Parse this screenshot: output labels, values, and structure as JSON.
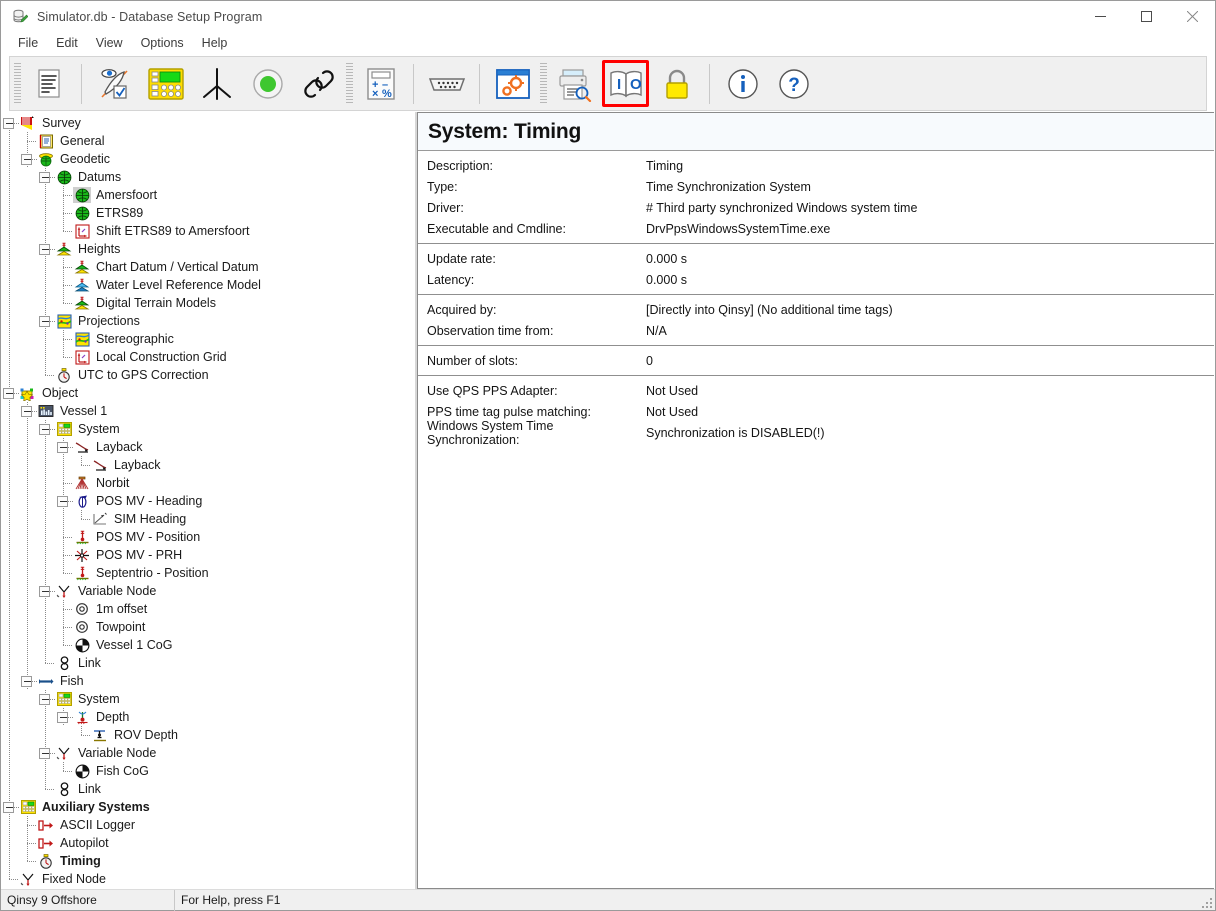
{
  "window": {
    "title": "Simulator.db - Database Setup Program",
    "icon": "database-program-icon",
    "controls": [
      {
        "name": "minimize-button",
        "glyph": "—"
      },
      {
        "name": "maximize-button",
        "glyph": "□"
      },
      {
        "name": "close-button",
        "glyph": "✕"
      }
    ]
  },
  "menu": {
    "items": [
      "File",
      "Edit",
      "View",
      "Options",
      "Help"
    ]
  },
  "toolbar": {
    "highlight_color": "#ff0000",
    "buttons": [
      {
        "name": "report-icon",
        "tip": "Report"
      },
      {
        "name": "survey-setup-icon",
        "tip": "Survey"
      },
      {
        "name": "computation-setup-icon",
        "tip": "Computation Setup"
      },
      {
        "name": "node-icon",
        "tip": "Node"
      },
      {
        "name": "object-icon",
        "tip": "Object"
      },
      {
        "name": "link-icon",
        "tip": "Link"
      },
      {
        "name": "calculator-icon",
        "tip": "Calculator"
      },
      {
        "name": "serial-port-icon",
        "tip": "I/O Ports"
      },
      {
        "name": "driver-settings-icon",
        "tip": "Driver Settings"
      },
      {
        "name": "print-preview-icon",
        "tip": "Print Preview"
      },
      {
        "name": "io-book-icon",
        "tip": "I/O Tester",
        "highlighted": true
      },
      {
        "name": "lock-icon",
        "tip": "Lock"
      },
      {
        "name": "info-icon",
        "tip": "About"
      },
      {
        "name": "help-icon",
        "tip": "Help"
      }
    ]
  },
  "tree": {
    "nodes": [
      {
        "label": "Survey",
        "depth": 0,
        "expander": "minus",
        "icon": "survey-icon",
        "last": false
      },
      {
        "label": "General",
        "depth": 1,
        "expander": "none",
        "icon": "general-icon",
        "last": false
      },
      {
        "label": "Geodetic",
        "depth": 1,
        "expander": "minus",
        "icon": "geodetic-icon",
        "last": true
      },
      {
        "label": "Datums",
        "depth": 2,
        "expander": "minus",
        "icon": "datum-globe-icon",
        "last": false
      },
      {
        "label": "Amersfoort",
        "depth": 3,
        "expander": "none",
        "icon": "datum-globe-icon",
        "last": false,
        "selected": true
      },
      {
        "label": "ETRS89",
        "depth": 3,
        "expander": "none",
        "icon": "datum-globe-icon",
        "last": false
      },
      {
        "label": "Shift ETRS89 to Amersfoort",
        "depth": 3,
        "expander": "none",
        "icon": "shift-axes-icon",
        "last": true
      },
      {
        "label": "Heights",
        "depth": 2,
        "expander": "minus",
        "icon": "heights-icon",
        "last": false
      },
      {
        "label": "Chart Datum / Vertical Datum",
        "depth": 3,
        "expander": "none",
        "icon": "heights-icon",
        "last": false
      },
      {
        "label": "Water Level Reference Model",
        "depth": 3,
        "expander": "none",
        "icon": "waterlevel-icon",
        "last": false
      },
      {
        "label": "Digital Terrain Models",
        "depth": 3,
        "expander": "none",
        "icon": "heights-icon",
        "last": true
      },
      {
        "label": "Projections",
        "depth": 2,
        "expander": "minus",
        "icon": "projection-icon",
        "last": false
      },
      {
        "label": "Stereographic",
        "depth": 3,
        "expander": "none",
        "icon": "projection-icon",
        "last": false
      },
      {
        "label": "Local Construction Grid",
        "depth": 3,
        "expander": "none",
        "icon": "shift-axes-icon",
        "last": true
      },
      {
        "label": "UTC to GPS Correction",
        "depth": 2,
        "expander": "none",
        "icon": "stopwatch-icon",
        "last": true
      },
      {
        "label": "Object",
        "depth": 0,
        "expander": "minus",
        "icon": "object-icon",
        "last": false
      },
      {
        "label": "Vessel 1",
        "depth": 1,
        "expander": "minus",
        "icon": "vessel-icon",
        "last": false
      },
      {
        "label": "System",
        "depth": 2,
        "expander": "minus",
        "icon": "system-icon",
        "last": false
      },
      {
        "label": "Layback",
        "depth": 3,
        "expander": "minus",
        "icon": "layback-icon",
        "last": false
      },
      {
        "label": "Layback",
        "depth": 4,
        "expander": "none",
        "icon": "layback-icon",
        "last": true
      },
      {
        "label": "Norbit",
        "depth": 3,
        "expander": "none",
        "icon": "multibeam-icon",
        "last": false
      },
      {
        "label": "POS MV - Heading",
        "depth": 3,
        "expander": "minus",
        "icon": "gyro-icon",
        "last": false
      },
      {
        "label": "SIM Heading",
        "depth": 4,
        "expander": "none",
        "icon": "sim-heading-icon",
        "last": true
      },
      {
        "label": "POS MV - Position",
        "depth": 3,
        "expander": "none",
        "icon": "position-icon",
        "last": false
      },
      {
        "label": "POS MV - PRH",
        "depth": 3,
        "expander": "none",
        "icon": "prh-icon",
        "last": false
      },
      {
        "label": "Septentrio - Position",
        "depth": 3,
        "expander": "none",
        "icon": "position-icon",
        "last": true
      },
      {
        "label": "Variable Node",
        "depth": 2,
        "expander": "minus",
        "icon": "variable-node-icon",
        "last": false
      },
      {
        "label": "1m offset",
        "depth": 3,
        "expander": "none",
        "icon": "node-point-icon",
        "last": false
      },
      {
        "label": "Towpoint",
        "depth": 3,
        "expander": "none",
        "icon": "node-point-icon",
        "last": false
      },
      {
        "label": "Vessel 1 CoG",
        "depth": 3,
        "expander": "none",
        "icon": "cog-icon",
        "last": true
      },
      {
        "label": "Link",
        "depth": 2,
        "expander": "none",
        "icon": "chain-link-icon",
        "last": true
      },
      {
        "label": "Fish",
        "depth": 1,
        "expander": "minus",
        "icon": "fish-icon",
        "last": true
      },
      {
        "label": "System",
        "depth": 2,
        "expander": "minus",
        "icon": "system-icon",
        "last": false
      },
      {
        "label": "Depth",
        "depth": 3,
        "expander": "minus",
        "icon": "depth-icon",
        "last": true
      },
      {
        "label": "ROV Depth",
        "depth": 4,
        "expander": "none",
        "icon": "rov-depth-icon",
        "last": true
      },
      {
        "label": "Variable Node",
        "depth": 2,
        "expander": "minus",
        "icon": "variable-node-icon",
        "last": false
      },
      {
        "label": "Fish CoG",
        "depth": 3,
        "expander": "none",
        "icon": "cog-icon",
        "last": true
      },
      {
        "label": "Link",
        "depth": 2,
        "expander": "none",
        "icon": "chain-link-icon",
        "last": true
      },
      {
        "label": "Auxiliary Systems",
        "depth": 0,
        "expander": "minus",
        "icon": "system-icon",
        "last": false,
        "bold": true
      },
      {
        "label": "ASCII Logger",
        "depth": 1,
        "expander": "none",
        "icon": "logger-icon",
        "last": false
      },
      {
        "label": "Autopilot",
        "depth": 1,
        "expander": "none",
        "icon": "logger-icon",
        "last": false
      },
      {
        "label": "Timing",
        "depth": 1,
        "expander": "none",
        "icon": "stopwatch-icon",
        "last": true,
        "bold": true
      },
      {
        "label": "Fixed Node",
        "depth": 0,
        "expander": "none",
        "icon": "variable-node-icon",
        "last": true
      }
    ]
  },
  "detail": {
    "header": "System: Timing",
    "groups": [
      {
        "rows": [
          {
            "label": "Description:",
            "value": "Timing"
          },
          {
            "label": "Type:",
            "value": "Time Synchronization System"
          },
          {
            "label": "Driver:",
            "value": "# Third party synchronized Windows system time"
          },
          {
            "label": "Executable and Cmdline:",
            "value": "DrvPpsWindowsSystemTime.exe"
          }
        ]
      },
      {
        "rows": [
          {
            "label": "Update rate:",
            "value": "0.000 s"
          },
          {
            "label": "Latency:",
            "value": "0.000 s"
          }
        ]
      },
      {
        "rows": [
          {
            "label": "Acquired by:",
            "value": "[Directly into Qinsy] (No additional time tags)"
          },
          {
            "label": "Observation time from:",
            "value": "N/A"
          }
        ]
      },
      {
        "rows": [
          {
            "label": "Number of slots:",
            "value": "0"
          }
        ]
      },
      {
        "rows": [
          {
            "label": "Use QPS PPS Adapter:",
            "value": "Not Used"
          },
          {
            "label": "PPS time tag pulse matching:",
            "value": "Not Used"
          },
          {
            "label": "Windows System Time Synchronization:",
            "value": "Synchronization is DISABLED(!)"
          }
        ]
      }
    ]
  },
  "statusbar": {
    "product": "Qinsy 9 Offshore",
    "hint": "For Help, press F1"
  }
}
